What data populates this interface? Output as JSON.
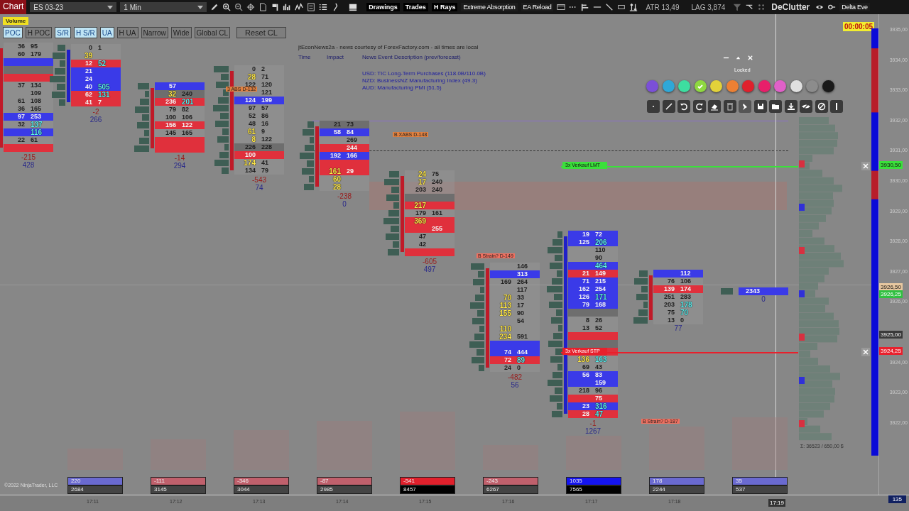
{
  "toolbar": {
    "chart_label": "Chart",
    "instrument": "ES 03-23",
    "interval": "1 Min",
    "buttons": [
      {
        "label": "Drawings",
        "kind": "text"
      },
      {
        "label": "Trades",
        "kind": "text"
      },
      {
        "label": "H Rays",
        "kind": "text"
      },
      {
        "label": "Extreme Absorption",
        "kind": "plain"
      },
      {
        "label": "EA Reload",
        "kind": "plain"
      }
    ],
    "atr": "ATR 13,49",
    "lag": "LAG 3,874",
    "declutter": "DeClutter",
    "delta": "Delta Eve"
  },
  "indicator_bar": {
    "badge": "Volume",
    "toggles": [
      {
        "label": "POC",
        "selected": true
      },
      {
        "label": "H POC",
        "selected": false
      },
      {
        "label": "S/R",
        "selected": true
      },
      {
        "label": "H S/R",
        "selected": true
      },
      {
        "label": "UA",
        "selected": true
      },
      {
        "label": "H UA",
        "selected": false
      },
      {
        "label": "Narrow",
        "selected": false
      },
      {
        "label": "Wide",
        "selected": false
      },
      {
        "label": "Global CL",
        "selected": false
      }
    ],
    "reset": "Reset CL"
  },
  "timer": "00:00:05",
  "news": {
    "header": "jtEconNews2a - news courtesy of ForexFactory.com - all times are local",
    "time_label": "Time",
    "impact_label": "Impact",
    "description_label": "News Event Description (prev/forecast)",
    "events": [
      "USD: TIC Long-Term Purchases (118.0B/110.0B)",
      "NZD: BusinessNZ Manufacturing Index (49.3)",
      "AUD: Manufacturing PMI (51.5)"
    ]
  },
  "footprints": [
    {
      "kind": "down",
      "delta": "-215",
      "volume": "428",
      "rows": [
        {
          "bid": "36",
          "ask": "95",
          "kind": "plain",
          "bid_hot": false,
          "ask_hot": false
        },
        {
          "bid": "60",
          "ask": "179",
          "kind": "plain",
          "bid_hot": false,
          "ask_hot": false
        },
        {
          "kind": "buy"
        },
        {
          "kind": "neutral"
        },
        {
          "kind": "sell"
        },
        {
          "bid": "37",
          "ask": "134",
          "kind": "plain",
          "bid_hot": false,
          "ask_hot": false
        },
        {
          "ask": "109",
          "kind": "plain",
          "ask_hot": false
        },
        {
          "bid": "61",
          "ask": "108",
          "kind": "plain",
          "bid_hot": false,
          "ask_hot": false
        },
        {
          "bid": "36",
          "ask": "165",
          "kind": "plain",
          "bid_hot": false,
          "ask_hot": false
        },
        {
          "bid": "97",
          "ask": "253",
          "kind": "buy",
          "bid_hot": false,
          "ask_hot": false
        },
        {
          "bid": "32",
          "ask": "137",
          "kind": "plain",
          "bid_hot": false,
          "ask_hot": true
        },
        {
          "ask": "116",
          "kind": "buy",
          "ask_hot": true
        },
        {
          "bid": "22",
          "ask": "61",
          "kind": "plain",
          "bid_hot": false,
          "ask_hot": false
        },
        {
          "kind": "sell"
        }
      ]
    },
    {
      "kind": "up",
      "delta": "-2",
      "volume": "266",
      "rows": [
        {
          "bid": "0",
          "ask": "1",
          "kind": "plain",
          "bid_hot": false,
          "ask_hot": false
        },
        {
          "bid": "39",
          "kind": "plain",
          "bid_hot": true
        },
        {
          "bid": "12",
          "ask": "52",
          "kind": "sell",
          "bid_hot": false,
          "ask_hot": true
        },
        {
          "bid": "21",
          "kind": "buy",
          "bid_hot": false
        },
        {
          "bid": "24",
          "kind": "buy",
          "bid_hot": false
        },
        {
          "bid": "40",
          "ask": "505",
          "kind": "buy",
          "bid_hot": false,
          "ask_hot": true
        },
        {
          "bid": "62",
          "ask": "131",
          "kind": "sell",
          "bid_hot": false,
          "ask_hot": true
        },
        {
          "bid": "41",
          "ask": "7",
          "kind": "sell",
          "bid_hot": false,
          "ask_hot": false
        }
      ]
    },
    {
      "kind": "down",
      "delta": "-14",
      "volume": "294",
      "rows": [
        {
          "bid": "57",
          "kind": "buy",
          "bid_hot": false
        },
        {
          "bid": "32",
          "ask": "240",
          "kind": "neutral",
          "bid_hot": true,
          "ask_hot": false
        },
        {
          "bid": "236",
          "ask": "201",
          "kind": "sell",
          "bid_hot": false,
          "ask_hot": true
        },
        {
          "bid": "79",
          "ask": "82",
          "kind": "plain",
          "bid_hot": false,
          "ask_hot": false
        },
        {
          "bid": "100",
          "ask": "106",
          "kind": "plain",
          "bid_hot": false,
          "ask_hot": false
        },
        {
          "bid": "156",
          "ask": "122",
          "kind": "sell",
          "bid_hot": false,
          "ask_hot": false
        },
        {
          "bid": "145",
          "ask": "165",
          "kind": "plain",
          "bid_hot": false,
          "ask_hot": false
        },
        {
          "kind": "sell"
        },
        {
          "kind": "sell"
        }
      ]
    },
    {
      "kind": "down",
      "delta": "-543",
      "volume": "74",
      "rows": [
        {
          "bid": "0",
          "ask": "2",
          "kind": "plain",
          "bid_hot": false,
          "ask_hot": false
        },
        {
          "bid": "28",
          "ask": "71",
          "kind": "plain",
          "bid_hot": true,
          "ask_hot": false
        },
        {
          "bid": "122",
          "ask": "120",
          "kind": "plain",
          "bid_hot": false,
          "ask_hot": false
        },
        {
          "ask": "121",
          "kind": "plain",
          "ask_hot": false
        },
        {
          "bid": "124",
          "ask": "199",
          "kind": "buy",
          "bid_hot": false,
          "ask_hot": false
        },
        {
          "bid": "97",
          "ask": "57",
          "kind": "plain",
          "bid_hot": false,
          "ask_hot": false
        },
        {
          "bid": "52",
          "ask": "86",
          "kind": "plain",
          "bid_hot": false,
          "ask_hot": false
        },
        {
          "bid": "48",
          "ask": "16",
          "kind": "plain",
          "bid_hot": false,
          "ask_hot": false
        },
        {
          "bid": "61",
          "ask": "9",
          "kind": "plain",
          "bid_hot": true,
          "ask_hot": false
        },
        {
          "bid": "8",
          "ask": "122",
          "kind": "plain",
          "bid_hot": true,
          "ask_hot": false
        },
        {
          "bid": "226",
          "ask": "228",
          "kind": "neutral",
          "bid_hot": false,
          "ask_hot": false
        },
        {
          "bid": "100",
          "kind": "sell",
          "bid_hot": false
        },
        {
          "bid": "174",
          "ask": "41",
          "kind": "plain",
          "bid_hot": true,
          "ask_hot": false
        },
        {
          "bid": "134",
          "ask": "79",
          "kind": "plain",
          "bid_hot": false,
          "ask_hot": false
        }
      ]
    },
    {
      "kind": "down",
      "delta": "-238",
      "volume": "0",
      "rows": [
        {
          "bid": "21",
          "ask": "73",
          "kind": "neutral",
          "bid_hot": false,
          "ask_hot": false
        },
        {
          "bid": "58",
          "ask": "84",
          "kind": "buy",
          "bid_hot": false,
          "ask_hot": false
        },
        {
          "ask": "269",
          "kind": "plain",
          "ask_hot": false
        },
        {
          "ask": "244",
          "kind": "sell",
          "ask_hot": false
        },
        {
          "bid": "192",
          "ask": "166",
          "kind": "buy",
          "bid_hot": false,
          "ask_hot": false
        },
        {
          "kind": "sell"
        },
        {
          "bid": "161",
          "ask": "29",
          "kind": "sell",
          "bid_hot": true,
          "ask_hot": false
        },
        {
          "bid": "60",
          "kind": "plain",
          "bid_hot": true
        },
        {
          "bid": "28",
          "kind": "plain",
          "bid_hot": true
        }
      ]
    },
    {
      "kind": "down",
      "delta": "-605",
      "volume": "497",
      "rows": [
        {
          "bid": "24",
          "ask": "75",
          "kind": "plain",
          "bid_hot": true,
          "ask_hot": false
        },
        {
          "bid": "17",
          "ask": "240",
          "kind": "plain",
          "bid_hot": true,
          "ask_hot": false
        },
        {
          "bid": "203",
          "ask": "240",
          "kind": "plain",
          "bid_hot": false,
          "ask_hot": false
        },
        {
          "kind": "neutral"
        },
        {
          "bid": "217",
          "kind": "sell",
          "bid_hot": true
        },
        {
          "bid": "179",
          "ask": "161",
          "kind": "plain",
          "bid_hot": false,
          "ask_hot": false
        },
        {
          "bid": "369",
          "kind": "sell",
          "bid_hot": true
        },
        {
          "ask": "255",
          "kind": "sell",
          "ask_hot": false
        },
        {
          "bid": "47",
          "kind": "plain",
          "bid_hot": false
        },
        {
          "bid": "42",
          "kind": "plain",
          "bid_hot": false
        },
        {
          "kind": "sell"
        }
      ]
    },
    {
      "kind": "down",
      "delta": "-482",
      "volume": "56",
      "rows": [
        {
          "ask": "146",
          "kind": "plain",
          "ask_hot": false
        },
        {
          "ask": "313",
          "kind": "buy",
          "ask_hot": false
        },
        {
          "bid": "169",
          "ask": "264",
          "kind": "plain",
          "bid_hot": false,
          "ask_hot": false
        },
        {
          "ask": "117",
          "kind": "plain",
          "ask_hot": false
        },
        {
          "bid": "70",
          "ask": "33",
          "kind": "plain",
          "bid_hot": true,
          "ask_hot": false
        },
        {
          "bid": "113",
          "ask": "17",
          "kind": "plain",
          "bid_hot": true,
          "ask_hot": false
        },
        {
          "bid": "155",
          "ask": "90",
          "kind": "plain",
          "bid_hot": true,
          "ask_hot": false
        },
        {
          "ask": "54",
          "kind": "plain",
          "ask_hot": false
        },
        {
          "bid": "110",
          "kind": "plain",
          "bid_hot": true
        },
        {
          "bid": "234",
          "ask": "591",
          "kind": "plain",
          "bid_hot": true,
          "ask_hot": false
        },
        {
          "kind": "buy"
        },
        {
          "bid": "74",
          "ask": "444",
          "kind": "buy",
          "bid_hot": false,
          "ask_hot": false
        },
        {
          "bid": "72",
          "ask": "89",
          "kind": "sell",
          "bid_hot": false,
          "ask_hot": true
        },
        {
          "bid": "24",
          "ask": "0",
          "kind": "plain",
          "bid_hot": false,
          "ask_hot": false
        }
      ]
    },
    {
      "kind": "up",
      "delta": "-1",
      "volume": "1267",
      "rows": [
        {
          "bid": "19",
          "ask": "72",
          "kind": "buy",
          "bid_hot": false,
          "ask_hot": false
        },
        {
          "bid": "125",
          "ask": "206",
          "kind": "buy",
          "bid_hot": false,
          "ask_hot": true
        },
        {
          "ask": "110",
          "kind": "plain",
          "ask_hot": false
        },
        {
          "ask": "90",
          "kind": "plain",
          "ask_hot": false
        },
        {
          "ask": "464",
          "kind": "buy",
          "ask_hot": true
        },
        {
          "bid": "21",
          "ask": "149",
          "kind": "sell",
          "bid_hot": false,
          "ask_hot": false
        },
        {
          "bid": "71",
          "ask": "215",
          "kind": "buy",
          "bid_hot": false,
          "ask_hot": false
        },
        {
          "bid": "162",
          "ask": "254",
          "kind": "buy",
          "bid_hot": false,
          "ask_hot": false
        },
        {
          "bid": "126",
          "ask": "171",
          "kind": "buy",
          "bid_hot": false,
          "ask_hot": true
        },
        {
          "bid": "79",
          "ask": "168",
          "kind": "buy",
          "bid_hot": false,
          "ask_hot": false
        },
        {
          "kind": "neutral"
        },
        {
          "bid": "8",
          "ask": "26",
          "kind": "plain",
          "bid_hot": false,
          "ask_hot": false
        },
        {
          "bid": "13",
          "ask": "52",
          "kind": "plain",
          "bid_hot": false,
          "ask_hot": false
        },
        {
          "kind": "sell"
        },
        {
          "kind": "neutral"
        },
        {
          "kind": "sell"
        },
        {
          "bid": "136",
          "ask": "163",
          "kind": "plain",
          "bid_hot": true,
          "ask_hot": true
        },
        {
          "bid": "69",
          "ask": "43",
          "kind": "plain",
          "bid_hot": false,
          "ask_hot": false
        },
        {
          "bid": "56",
          "ask": "83",
          "kind": "buy",
          "bid_hot": false,
          "ask_hot": false
        },
        {
          "ask": "159",
          "kind": "buy",
          "ask_hot": false
        },
        {
          "bid": "218",
          "ask": "96",
          "kind": "plain",
          "bid_hot": false,
          "ask_hot": false
        },
        {
          "ask": "75",
          "kind": "sell",
          "ask_hot": false
        },
        {
          "bid": "23",
          "ask": "316",
          "kind": "buy",
          "bid_hot": false,
          "ask_hot": true
        },
        {
          "bid": "28",
          "ask": "47",
          "kind": "sell",
          "bid_hot": false,
          "ask_hot": true
        }
      ]
    },
    {
      "kind": "down",
      "volume": "77",
      "rows": [
        {
          "ask": "112",
          "kind": "buy",
          "ask_hot": false
        },
        {
          "bid": "76",
          "ask": "106",
          "kind": "plain",
          "bid_hot": false,
          "ask_hot": false
        },
        {
          "bid": "139",
          "ask": "174",
          "kind": "sell",
          "bid_hot": false,
          "ask_hot": false
        },
        {
          "bid": "251",
          "ask": "283",
          "kind": "plain",
          "bid_hot": false,
          "ask_hot": false
        },
        {
          "bid": "203",
          "ask": "178",
          "kind": "plain",
          "bid_hot": false,
          "ask_hot": true
        },
        {
          "bid": "75",
          "ask": "70",
          "kind": "plain",
          "bid_hot": false,
          "ask_hot": true
        },
        {
          "bid": "13",
          "ask": "0",
          "kind": "plain",
          "bid_hot": false,
          "ask_hot": false
        }
      ]
    },
    {
      "kind": "up",
      "volume": "0",
      "rows": [
        {
          "bid": "2343",
          "kind": "buy",
          "bid_hot": false
        }
      ]
    }
  ],
  "signals": [
    {
      "label": "3 ABS D-132",
      "kind": "absorption"
    },
    {
      "label": "B XABS D-148",
      "kind": "absorption"
    },
    {
      "label": "B Strain? D-149",
      "kind": "strain"
    },
    {
      "label": "B Strain? D-187",
      "kind": "strain"
    }
  ],
  "orders": [
    {
      "label": "3x  Verkauf LMT",
      "price": "3930,50",
      "kind": "limit"
    },
    {
      "label": "3x  Verkauf STP",
      "price": "3924,25",
      "kind": "stop"
    }
  ],
  "drawing_panel": {
    "status": "Locked",
    "colors": [
      {
        "color": "#7b4fd8",
        "selected": false
      },
      {
        "color": "#2fa8d8",
        "selected": false
      },
      {
        "color": "#3ddea0",
        "selected": false
      },
      {
        "color": "#8fd840",
        "selected": true
      },
      {
        "color": "#e2d23a",
        "selected": false
      },
      {
        "color": "#ec8034",
        "selected": false
      },
      {
        "color": "#e0202c",
        "selected": false
      },
      {
        "color": "#e81e6a",
        "selected": false
      },
      {
        "color": "#e060c8",
        "selected": false
      },
      {
        "color": "#e0e0e0",
        "selected": false
      },
      {
        "color": "#8c8c8c",
        "selected": false
      },
      {
        "color": "#1a1a1a",
        "selected": false
      }
    ]
  },
  "price_axis": [
    "3935,00",
    "3934,00",
    "3933,00",
    "3932,00",
    "3931,00",
    "3930,00",
    "3929,00",
    "3928,00",
    "3927,00",
    "3926,00",
    "3924,00",
    "3923,00",
    "3922,00"
  ],
  "price_markers": [
    {
      "price": "3926,50",
      "kind": "last"
    },
    {
      "price": "3926,25",
      "kind": "bid"
    },
    {
      "price": "3925,00",
      "kind": "cursor"
    }
  ],
  "profile_total": "Σ: 36523 / 650,00 $",
  "bar_stats": [
    {
      "delta": "220",
      "volume": "2684",
      "kind": "buy"
    },
    {
      "delta": "-111",
      "volume": "3145",
      "kind": "sell"
    },
    {
      "delta": "-346",
      "volume": "3044",
      "kind": "sell"
    },
    {
      "delta": "-87",
      "volume": "2985",
      "kind": "sell"
    },
    {
      "delta": "-541",
      "volume": "8457",
      "kind": "sell-strong"
    },
    {
      "delta": "-243",
      "volume": "6267",
      "kind": "sell"
    },
    {
      "delta": "1035",
      "volume": "7565",
      "kind": "buy-strong"
    },
    {
      "delta": "178",
      "volume": "2244",
      "kind": "buy"
    },
    {
      "delta": "35",
      "volume": "537",
      "kind": "buy"
    }
  ],
  "copyright": "©2022 NinjaTrader, LLC",
  "time_axis": [
    {
      "label": "17:11",
      "selected": false
    },
    {
      "label": "17:12",
      "selected": false
    },
    {
      "label": "17:13",
      "selected": false
    },
    {
      "label": "17:14",
      "selected": false
    },
    {
      "label": "17:15",
      "selected": false
    },
    {
      "label": "17:16",
      "selected": false
    },
    {
      "label": "17:17",
      "selected": false
    },
    {
      "label": "17:18",
      "selected": false
    },
    {
      "label": "17:19",
      "selected": true
    }
  ],
  "corner_value": "135"
}
